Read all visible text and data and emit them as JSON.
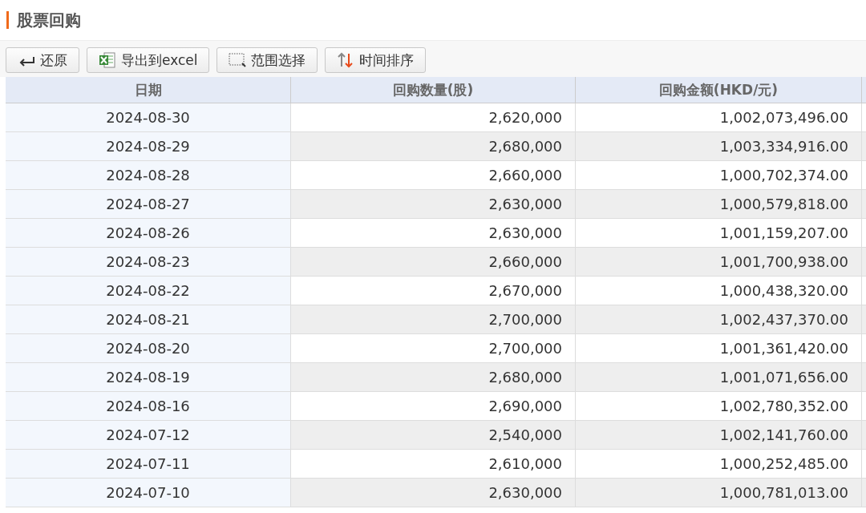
{
  "title": "股票回购",
  "toolbar": [
    {
      "kind": "undo",
      "label": "还原"
    },
    {
      "kind": "excel",
      "label": "导出到excel"
    },
    {
      "kind": "range",
      "label": "范围选择"
    },
    {
      "kind": "sort",
      "label": "时间排序"
    }
  ],
  "table": {
    "columns": [
      "日期",
      "回购数量(股)",
      "回购金额(HKD/元)"
    ],
    "rows": [
      [
        "2024-08-30",
        "2,620,000",
        "1,002,073,496.00"
      ],
      [
        "2024-08-29",
        "2,680,000",
        "1,003,334,916.00"
      ],
      [
        "2024-08-28",
        "2,660,000",
        "1,000,702,374.00"
      ],
      [
        "2024-08-27",
        "2,630,000",
        "1,000,579,818.00"
      ],
      [
        "2024-08-26",
        "2,630,000",
        "1,001,159,207.00"
      ],
      [
        "2024-08-23",
        "2,660,000",
        "1,001,700,938.00"
      ],
      [
        "2024-08-22",
        "2,670,000",
        "1,000,438,320.00"
      ],
      [
        "2024-08-21",
        "2,700,000",
        "1,002,437,370.00"
      ],
      [
        "2024-08-20",
        "2,700,000",
        "1,001,361,420.00"
      ],
      [
        "2024-08-19",
        "2,680,000",
        "1,001,071,656.00"
      ],
      [
        "2024-08-16",
        "2,690,000",
        "1,002,780,352.00"
      ],
      [
        "2024-07-12",
        "2,540,000",
        "1,002,141,760.00"
      ],
      [
        "2024-07-11",
        "2,610,000",
        "1,000,252,485.00"
      ],
      [
        "2024-07-10",
        "2,630,000",
        "1,000,781,013.00"
      ]
    ]
  }
}
